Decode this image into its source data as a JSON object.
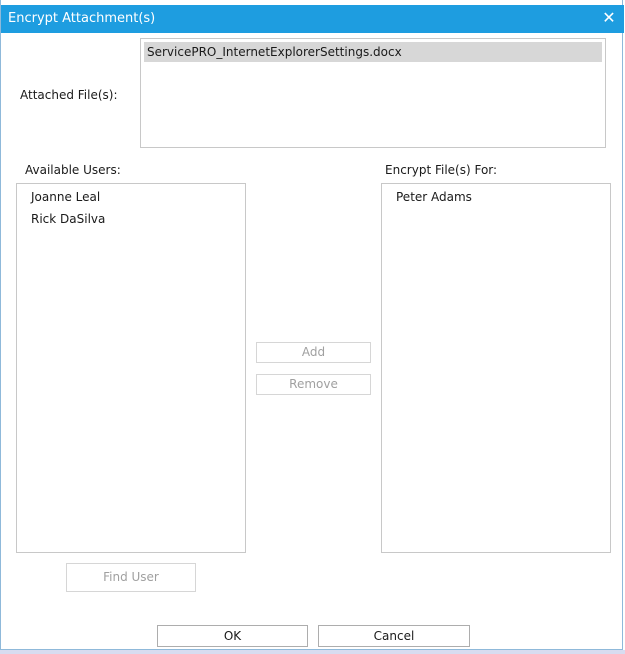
{
  "dialog": {
    "title": "Encrypt Attachment(s)",
    "close_glyph": "✕"
  },
  "attached": {
    "label": "Attached File(s):",
    "files": [
      "ServicePRO_InternetExplorerSettings.docx"
    ]
  },
  "available": {
    "label": "Available Users:",
    "users": [
      "Joanne Leal",
      "Rick DaSilva"
    ]
  },
  "encrypt_for": {
    "label": "Encrypt File(s) For:",
    "users": [
      "Peter Adams"
    ]
  },
  "buttons": {
    "add": "Add",
    "remove": "Remove",
    "find_user": "Find User",
    "ok": "OK",
    "cancel": "Cancel"
  },
  "colors": {
    "titlebar": "#1e9de0",
    "selection": "#d7d7d7"
  },
  "icons": {
    "close": "close-icon"
  }
}
